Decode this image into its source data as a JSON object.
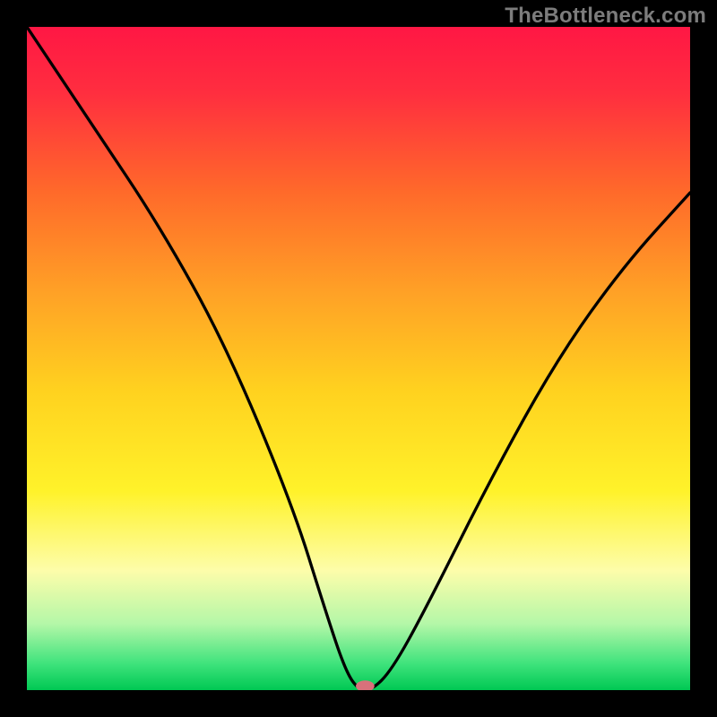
{
  "watermark": "TheBottleneck.com",
  "chart_data": {
    "type": "line",
    "title": "",
    "xlabel": "",
    "ylabel": "",
    "xlim": [
      0,
      100
    ],
    "ylim": [
      0,
      100
    ],
    "series": [
      {
        "name": "curve",
        "x": [
          0,
          10,
          20,
          30,
          40,
          45,
          48,
          50,
          52,
          55,
          60,
          70,
          80,
          90,
          100
        ],
        "values": [
          100,
          85,
          70,
          52,
          28,
          12,
          3,
          0,
          0,
          3,
          12,
          32,
          50,
          64,
          75
        ]
      }
    ],
    "marker": {
      "x": 51,
      "y": 0.6,
      "color": "#d9717b"
    },
    "gradient_stops": [
      {
        "offset": 0.0,
        "color": "#ff1744"
      },
      {
        "offset": 0.1,
        "color": "#ff2e3f"
      },
      {
        "offset": 0.25,
        "color": "#ff6a2a"
      },
      {
        "offset": 0.4,
        "color": "#ffa126"
      },
      {
        "offset": 0.55,
        "color": "#ffd21f"
      },
      {
        "offset": 0.7,
        "color": "#fff22a"
      },
      {
        "offset": 0.82,
        "color": "#fdfdaa"
      },
      {
        "offset": 0.9,
        "color": "#b4f7a8"
      },
      {
        "offset": 0.96,
        "color": "#3fe37c"
      },
      {
        "offset": 1.0,
        "color": "#00c853"
      }
    ]
  }
}
